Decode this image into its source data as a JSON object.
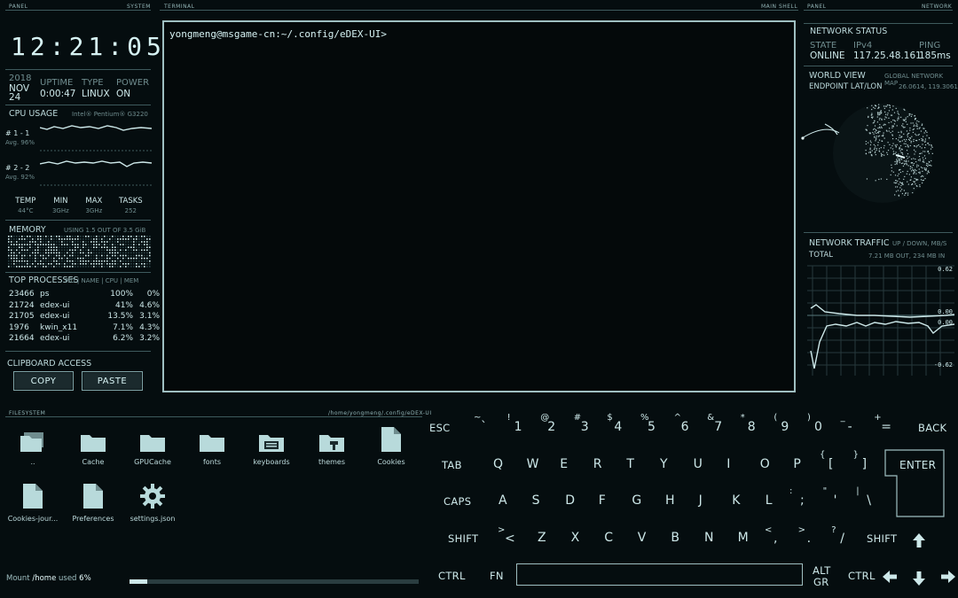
{
  "headers": {
    "panel_left": "PANEL",
    "system": "SYSTEM",
    "terminal": "TERMINAL",
    "main_shell": "MAIN SHELL",
    "panel_right": "PANEL",
    "network": "NETWORK",
    "filesystem": "FILESYSTEM",
    "fs_path": "/home/yongmeng/.config/eDEX-UI"
  },
  "clock": "12:21:05",
  "date": {
    "year": "2018",
    "month": "NOV",
    "day": "24"
  },
  "uptime": {
    "label": "UPTIME",
    "value": "0:00:47"
  },
  "type": {
    "label": "TYPE",
    "value": "LINUX"
  },
  "power": {
    "label": "POWER",
    "value": "ON"
  },
  "cpu": {
    "title": "CPU USAGE",
    "model": "Intel® Pentium® G3220",
    "cores": [
      {
        "id": "# 1 - 1",
        "avg": "Avg. 96%"
      },
      {
        "id": "# 2 - 2",
        "avg": "Avg. 92%"
      }
    ],
    "stats": [
      {
        "label": "TEMP",
        "value": "44°C"
      },
      {
        "label": "MIN",
        "value": "3GHz"
      },
      {
        "label": "MAX",
        "value": "3GHz"
      },
      {
        "label": "TASKS",
        "value": "252"
      }
    ]
  },
  "memory": {
    "title": "MEMORY",
    "usage": "USING 1.5 OUT OF 3.5 GiB"
  },
  "top": {
    "title": "TOP PROCESSES",
    "cols": "PID | NAME | CPU | MEM",
    "rows": [
      {
        "pid": "23466",
        "name": "ps",
        "cpu": "100%",
        "mem": "0%"
      },
      {
        "pid": "21724",
        "name": "edex-ui",
        "cpu": "41%",
        "mem": "4.6%"
      },
      {
        "pid": "21705",
        "name": "edex-ui",
        "cpu": "13.5%",
        "mem": "3.1%"
      },
      {
        "pid": "1976",
        "name": "kwin_x11",
        "cpu": "7.1%",
        "mem": "4.3%"
      },
      {
        "pid": "21664",
        "name": "edex-ui",
        "cpu": "6.2%",
        "mem": "3.2%"
      }
    ]
  },
  "clipboard": {
    "title": "CLIPBOARD ACCESS",
    "copy": "COPY",
    "paste": "PASTE"
  },
  "terminal": {
    "prompt": "yongmeng@msgame-cn:~/.config/eDEX-UI>"
  },
  "netstatus": {
    "title": "NETWORK STATUS",
    "state_label": "STATE",
    "state": "ONLINE",
    "ip_label": "IPv4",
    "ip": "117.25.48.161",
    "ping_label": "PING",
    "ping": "185ms"
  },
  "worldview": {
    "title": "WORLD VIEW",
    "subtitle": "GLOBAL NETWORK MAP",
    "endpoint_label": "ENDPOINT LAT/LON",
    "endpoint": "26.0614, 119.3061"
  },
  "traffic": {
    "title": "NETWORK TRAFFIC",
    "subtitle": "UP / DOWN, MB/S",
    "total_label": "TOTAL",
    "total": "7.21 MB OUT, 234 MB IN",
    "ticks": [
      "0.62",
      "0.00",
      "0.00",
      "-0.62"
    ]
  },
  "files": [
    {
      "name": "..",
      "icon": "folder-stack"
    },
    {
      "name": "Cache",
      "icon": "folder"
    },
    {
      "name": "GPUCache",
      "icon": "folder"
    },
    {
      "name": "fonts",
      "icon": "folder"
    },
    {
      "name": "keyboards",
      "icon": "keyboard-folder"
    },
    {
      "name": "themes",
      "icon": "paint-folder"
    },
    {
      "name": "Cookies",
      "icon": "file"
    },
    {
      "name": "Cookies-jour...",
      "icon": "file"
    },
    {
      "name": "Preferences",
      "icon": "file"
    },
    {
      "name": "settings.json",
      "icon": "gear"
    }
  ],
  "mount": {
    "pre": "Mount ",
    "path": "/home",
    "mid": " used ",
    "pct": "6%",
    "fraction": 0.06
  },
  "keyboard": {
    "row1": [
      [
        "~",
        "`"
      ],
      [
        "!",
        "1"
      ],
      [
        "@",
        "2"
      ],
      [
        "#",
        "3"
      ],
      [
        "$",
        "4"
      ],
      [
        "%",
        "5"
      ],
      [
        "^",
        "6"
      ],
      [
        "&",
        "7"
      ],
      [
        "*",
        "8"
      ],
      [
        "(",
        "9"
      ],
      [
        ")",
        "0"
      ],
      [
        "_",
        "-"
      ],
      [
        "+",
        "="
      ]
    ],
    "row2": [
      "Q",
      "W",
      "E",
      "R",
      "T",
      "Y",
      "U",
      "I",
      "O",
      "P"
    ],
    "row2b": [
      [
        "{",
        "["
      ],
      [
        "}",
        "]"
      ]
    ],
    "row3": [
      "A",
      "S",
      "D",
      "F",
      "G",
      "H",
      "J",
      "K",
      "L"
    ],
    "row3b": [
      [
        ":",
        ";"
      ],
      [
        "\"",
        "'"
      ],
      [
        "|",
        "\\"
      ]
    ],
    "row4": [
      "Z",
      "X",
      "C",
      "V",
      "B",
      "N",
      "M"
    ],
    "row4b": [
      [
        "<",
        ","
      ],
      [
        ">",
        "."
      ],
      [
        "?",
        "/"
      ]
    ],
    "row4a": [
      ">",
      "<"
    ],
    "esc": "ESC",
    "back": "BACK",
    "tab": "TAB",
    "enter": "ENTER",
    "caps": "CAPS",
    "shift": "SHIFT",
    "ctrl": "CTRL",
    "fn": "FN",
    "alt": "ALT",
    "gr": "GR"
  }
}
